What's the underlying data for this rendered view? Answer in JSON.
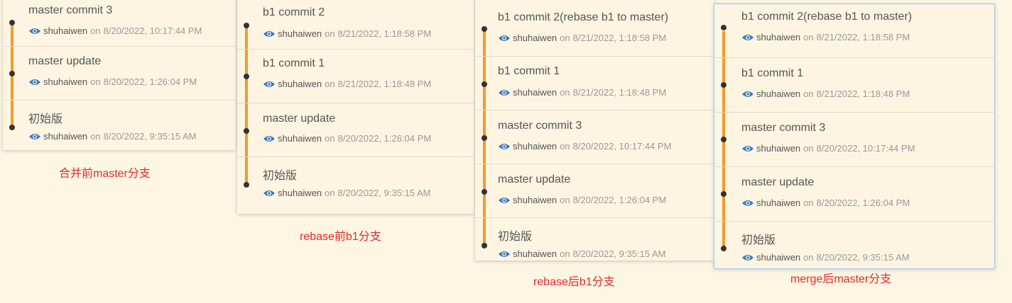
{
  "panels": [
    {
      "commits": [
        {
          "title": "master commit 3",
          "author": "shuhaiwen",
          "on": "on",
          "date": "8/20/2022, 10:17:44 PM"
        },
        {
          "title": "master update",
          "author": "shuhaiwen",
          "on": "on",
          "date": "8/20/2022, 1:26:04 PM"
        },
        {
          "title": "初始版",
          "author": "shuhaiwen",
          "on": "on",
          "date": "8/20/2022, 9:35:15 AM"
        }
      ],
      "caption": "合并前master分支"
    },
    {
      "commits": [
        {
          "title": "b1 commit 2",
          "author": "shuhaiwen",
          "on": "on",
          "date": "8/21/2022, 1:18:58 PM"
        },
        {
          "title": "b1 commit 1",
          "author": "shuhaiwen",
          "on": "on",
          "date": "8/21/2022, 1:18:48 PM"
        },
        {
          "title": "master update",
          "author": "shuhaiwen",
          "on": "on",
          "date": "8/20/2022, 1:26:04 PM"
        },
        {
          "title": "初始版",
          "author": "shuhaiwen",
          "on": "on",
          "date": "8/20/2022, 9:35:15 AM"
        }
      ],
      "caption": "rebase前b1分支"
    },
    {
      "commits": [
        {
          "title": "b1 commit 2(rebase b1 to master)",
          "author": "shuhaiwen",
          "on": "on",
          "date": "8/21/2022, 1:18:58 PM"
        },
        {
          "title": "b1 commit 1",
          "author": "shuhaiwen",
          "on": "on",
          "date": "8/21/2022, 1:18:48 PM"
        },
        {
          "title": "master commit 3",
          "author": "shuhaiwen",
          "on": "on",
          "date": "8/20/2022, 10:17:44 PM"
        },
        {
          "title": "master update",
          "author": "shuhaiwen",
          "on": "on",
          "date": "8/20/2022, 1:26:04 PM"
        },
        {
          "title": "初始版",
          "author": "shuhaiwen",
          "on": "on",
          "date": "8/20/2022, 9:35:15 AM"
        }
      ],
      "caption": "rebase后b1分支"
    },
    {
      "commits": [
        {
          "title": "b1 commit 2(rebase b1 to master)",
          "author": "shuhaiwen",
          "on": "on",
          "date": "8/21/2022, 1:18:58 PM"
        },
        {
          "title": "b1 commit 1",
          "author": "shuhaiwen",
          "on": "on",
          "date": "8/21/2022, 1:18:48 PM"
        },
        {
          "title": "master commit 3",
          "author": "shuhaiwen",
          "on": "on",
          "date": "8/20/2022, 10:17:44 PM"
        },
        {
          "title": "master update",
          "author": "shuhaiwen",
          "on": "on",
          "date": "8/20/2022, 1:26:04 PM"
        },
        {
          "title": "初始版",
          "author": "shuhaiwen",
          "on": "on",
          "date": "8/20/2022, 9:35:15 AM"
        }
      ],
      "caption": "merge后master分支"
    }
  ],
  "colors": {
    "background": "#fdf6e3",
    "branch_line": "#f39a2e",
    "commit_dot": "#333333",
    "eye_icon": "#3a7bbf",
    "caption": "#e8262c"
  },
  "icons": {
    "author": "eye-icon"
  }
}
